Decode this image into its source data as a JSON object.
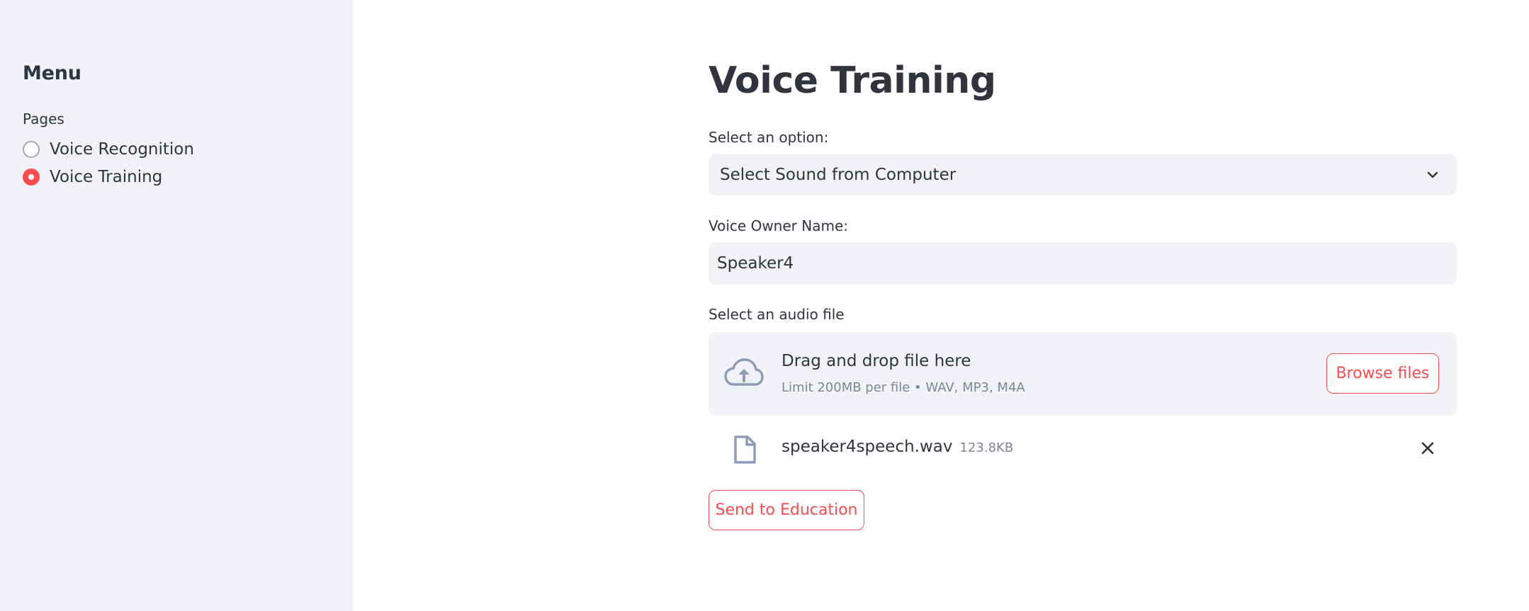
{
  "sidebar": {
    "title": "Menu",
    "pages_label": "Pages",
    "items": [
      {
        "label": "Voice Recognition",
        "selected": false
      },
      {
        "label": "Voice Training",
        "selected": true
      }
    ]
  },
  "main": {
    "title": "Voice Training",
    "option_label": "Select an option:",
    "option_value": "Select Sound from Computer",
    "owner_label": "Voice Owner Name:",
    "owner_value": "Speaker4",
    "audio_label": "Select an audio file",
    "dropzone": {
      "title": "Drag and drop file here",
      "subtitle": "Limit 200MB per file • WAV, MP3, M4A",
      "browse_label": "Browse files",
      "icon": "cloud-upload-icon"
    },
    "file": {
      "name": "speaker4speech.wav",
      "size": "123.8KB",
      "icon": "file-icon"
    },
    "send_label": "Send to Education"
  },
  "colors": {
    "accent": "#ff4b4b",
    "sidebar_bg": "#f0f2f6",
    "text": "#31333f",
    "muted": "#808495",
    "icon": "#8d9bb8"
  }
}
